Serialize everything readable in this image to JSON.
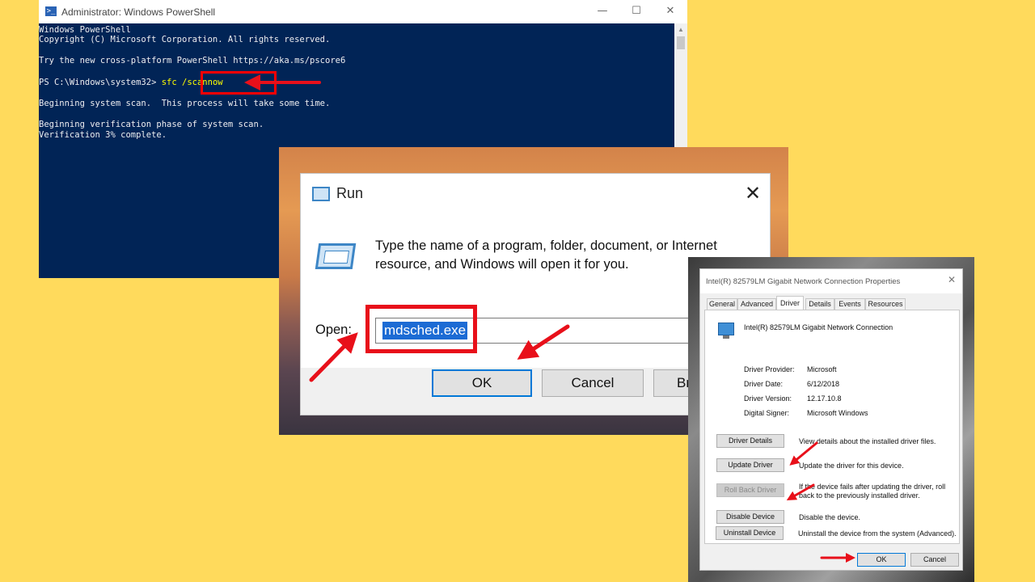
{
  "powershell": {
    "title": "Administrator: Windows PowerShell",
    "minimize": "—",
    "maximize": "☐",
    "close": "✕",
    "lines": {
      "l1": "Windows PowerShell",
      "l2": "Copyright (C) Microsoft Corporation. All rights reserved.",
      "l3": "Try the new cross-platform PowerShell https://aka.ms/pscore6",
      "prompt": "PS C:\\Windows\\system32>",
      "command": "sfc /scannow",
      "l5": "Beginning system scan.  This process will take some time.",
      "l6": "Beginning verification phase of system scan.",
      "l7": "Verification 3% complete."
    }
  },
  "run": {
    "title": "Run",
    "close": "✕",
    "description": "Type the name of a program, folder, document, or Internet resource, and Windows will open it for you.",
    "open_label": "Open:",
    "input_value": "mdsched.exe",
    "ok": "OK",
    "cancel": "Cancel",
    "browse": "Br"
  },
  "props": {
    "title": "Intel(R) 82579LM Gigabit Network Connection Properties",
    "close": "✕",
    "tabs": [
      "General",
      "Advanced",
      "Driver",
      "Details",
      "Events",
      "Resources"
    ],
    "active_tab": "Driver",
    "device_name": "Intel(R) 82579LM Gigabit Network Connection",
    "info": [
      {
        "key": "Driver Provider:",
        "value": "Microsoft"
      },
      {
        "key": "Driver Date:",
        "value": "6/12/2018"
      },
      {
        "key": "Driver Version:",
        "value": "12.17.10.8"
      },
      {
        "key": "Digital Signer:",
        "value": "Microsoft Windows"
      }
    ],
    "actions": [
      {
        "label": "Driver Details",
        "desc": "View details about the installed driver files."
      },
      {
        "label": "Update Driver",
        "desc": "Update the driver for this device."
      },
      {
        "label": "Roll Back Driver",
        "desc": "If the device fails after updating the driver, roll back to the previously installed driver."
      },
      {
        "label": "Disable Device",
        "desc": "Disable the device."
      },
      {
        "label": "Uninstall Device",
        "desc": "Uninstall the device from the system (Advanced)."
      }
    ],
    "ok": "OK",
    "cancel": "Cancel"
  },
  "colors": {
    "background": "#FFDA5C",
    "powershell_bg": "#012456",
    "highlight_red": "#E8101A",
    "selection_blue": "#1C6BD4"
  }
}
